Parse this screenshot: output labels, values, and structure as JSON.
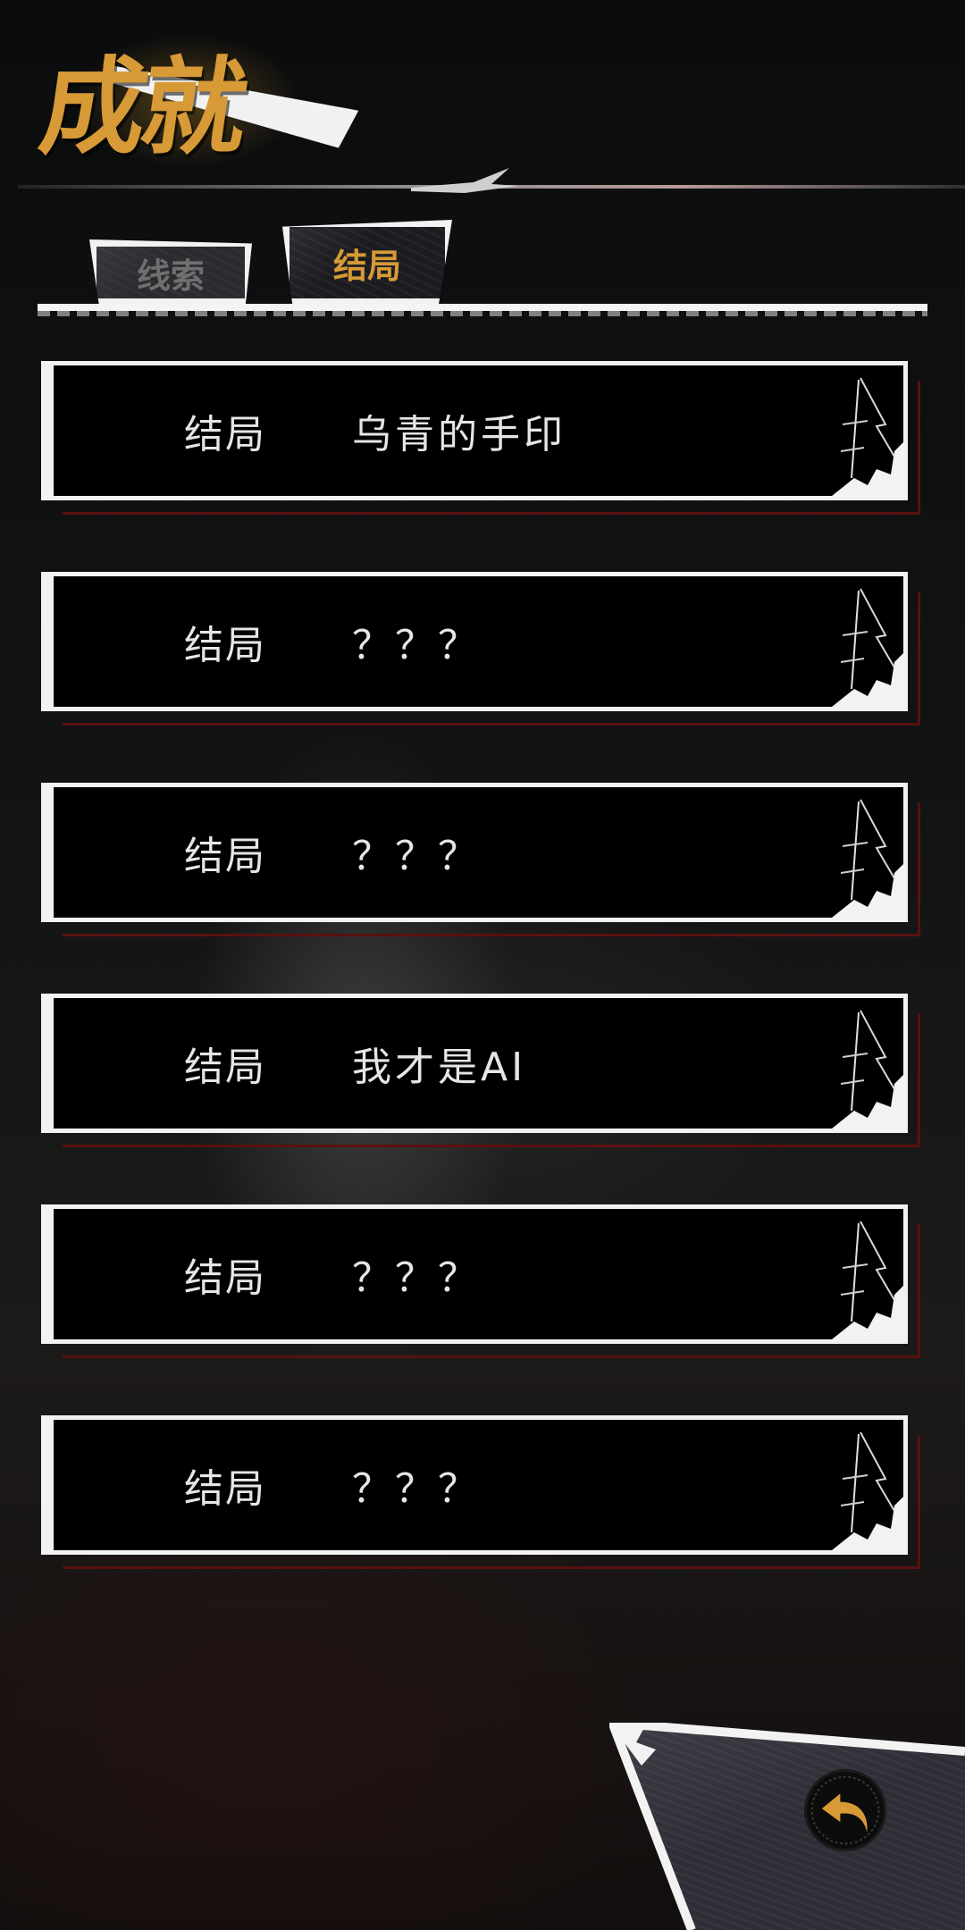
{
  "header": {
    "title": "成就"
  },
  "tabs": [
    {
      "label": "线索",
      "active": false
    },
    {
      "label": "结局",
      "active": true
    }
  ],
  "endings": [
    {
      "label": "结局",
      "title": "乌青的手印"
    },
    {
      "label": "结局",
      "title": "？？？"
    },
    {
      "label": "结局",
      "title": "？？？"
    },
    {
      "label": "结局",
      "title": "我才是AI"
    },
    {
      "label": "结局",
      "title": "？？？"
    },
    {
      "label": "结局",
      "title": "？？？"
    }
  ],
  "back": {
    "icon": "back-arrow-icon"
  },
  "colors": {
    "accent": "#d79a36",
    "frame": "#f2f2f2",
    "card": "#000000",
    "shadow_border": "#5a1010"
  }
}
